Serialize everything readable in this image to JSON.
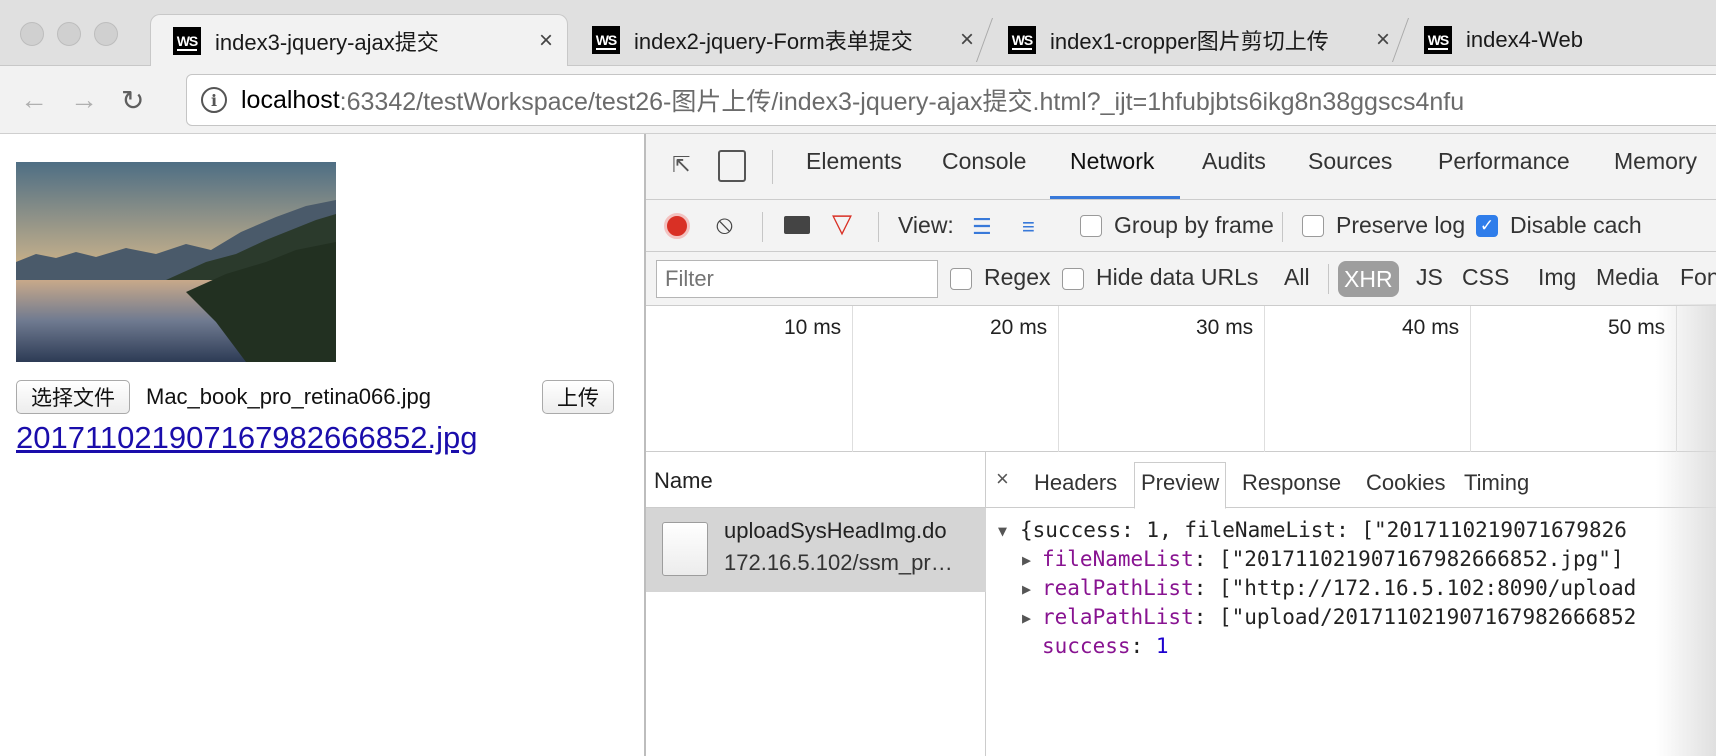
{
  "browser": {
    "tabs": [
      {
        "label": "index3-jquery-ajax提交",
        "favicon": "WS",
        "close": "×"
      },
      {
        "label": "index2-jquery-Form表单提交",
        "favicon": "WS",
        "close": "×"
      },
      {
        "label": "index1-cropper图片剪切上传",
        "favicon": "WS",
        "close": "×"
      },
      {
        "label": "index4-Web",
        "favicon": "WS"
      }
    ],
    "url_host": "localhost",
    "url_rest": ":63342/testWorkspace/test26-图片上传/index3-jquery-ajax提交.html?_ijt=1hfubjbts6ikg8n38ggscs4nfu"
  },
  "page": {
    "choose_file_label": "选择文件",
    "file_name": "Mac_book_pro_retina066.jpg",
    "upload_label": "上传",
    "result_link": "20171102190716798266685​2.jpg"
  },
  "devtools": {
    "tabs": [
      "Elements",
      "Console",
      "Network",
      "Audits",
      "Sources",
      "Performance",
      "Memory"
    ],
    "active_tab": "Network",
    "toolbar": {
      "view_label": "View:",
      "group_by_frame": "Group by frame",
      "preserve_log": "Preserve log",
      "disable_cache": "Disable cach"
    },
    "filter": {
      "placeholder": "Filter",
      "regex": "Regex",
      "hide_data_urls": "Hide data URLs",
      "types": [
        "All",
        "XHR",
        "JS",
        "CSS",
        "Img",
        "Media",
        "Fon"
      ],
      "active_type": "XHR"
    },
    "timeline_ticks": [
      "10 ms",
      "20 ms",
      "30 ms",
      "40 ms",
      "50 ms"
    ],
    "name_header": "Name",
    "request": {
      "name": "uploadSysHeadImg.do",
      "url": "172.16.5.102/ssm_pr…"
    },
    "detail_close": "×",
    "detail_tabs": [
      "Headers",
      "Preview",
      "Response",
      "Cookies",
      "Timing"
    ],
    "active_detail_tab": "Preview",
    "preview": {
      "summary": "{success: 1, fileNameList: [\"2017110219071679826",
      "lines": [
        {
          "key": "fileNameList",
          "value": ": [\"20171102190716798266685​2.jpg\"]"
        },
        {
          "key": "realPathList",
          "value": ": [\"http://172.16.5.102:8090/upload"
        },
        {
          "key": "relaPathList",
          "value": ": [\"upload/201711021907167982666852"
        }
      ],
      "success_key": "success",
      "success_value": "1"
    }
  },
  "colors": {
    "link": "#1a0dab",
    "devtools_accent": "#3879d9",
    "json_key": "#881391",
    "json_number": "#1c00cf"
  }
}
